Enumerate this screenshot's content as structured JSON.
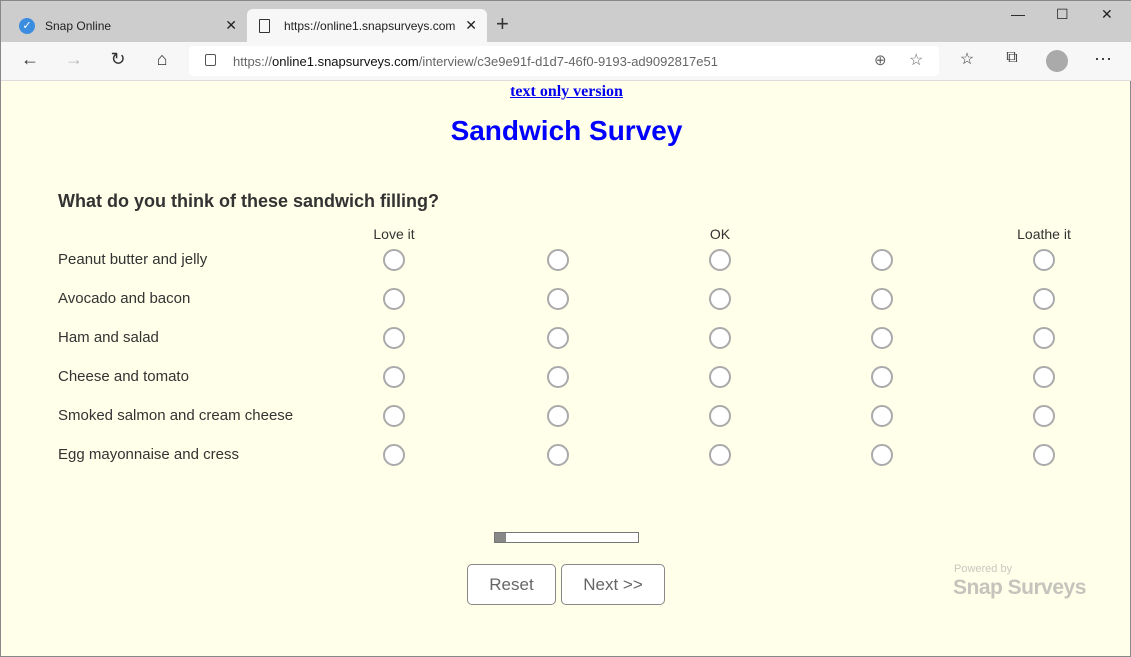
{
  "browser": {
    "tabs": [
      {
        "title": "Snap Online",
        "icon": "checkmark-badge-icon"
      },
      {
        "title": "https://online1.snapsurveys.com",
        "icon": "page-icon",
        "active": true
      }
    ],
    "url_prefix": "https://",
    "url_host": "online1.snapsurveys.com",
    "url_path": "/interview/c3e9e91f-d1d7-46f0-9193-ad9092817e51"
  },
  "page": {
    "text_only_link": "text only version",
    "title": "Sandwich Survey",
    "question": "What do you think of these sandwich filling?",
    "scale_headers": [
      "Love it",
      "",
      "OK",
      "",
      "Loathe it"
    ],
    "rows": [
      "Peanut butter and jelly",
      "Avocado and bacon",
      "Ham and salad",
      "Cheese and tomato",
      "Smoked salmon and cream cheese",
      "Egg mayonnaise and cress"
    ],
    "progress_percent": 8,
    "reset_label": "Reset",
    "next_label": "Next >>",
    "powered_by": "Powered by",
    "brand": "Snap Surveys"
  }
}
